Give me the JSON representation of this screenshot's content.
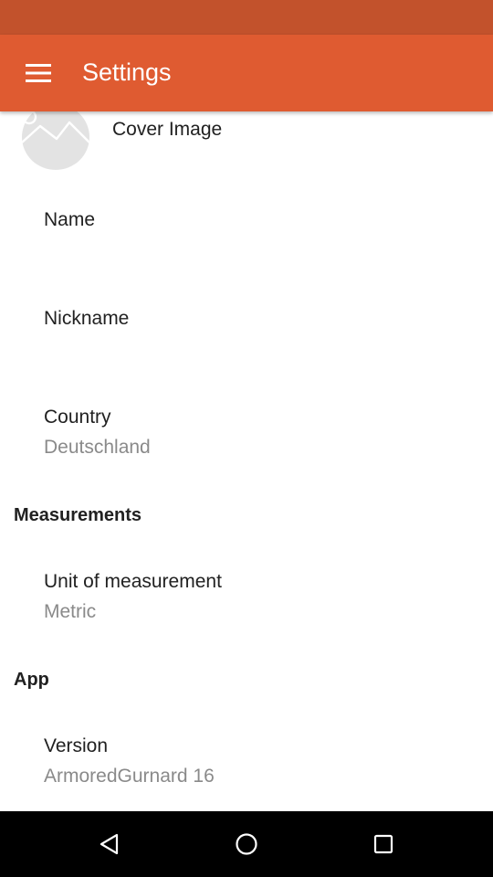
{
  "app_bar": {
    "title": "Settings",
    "menu_icon": "hamburger-menu-icon",
    "background": "#DF5B31",
    "status_bar_color": "#C2522C"
  },
  "cover": {
    "label": "Cover Image",
    "icon": "image-placeholder-icon"
  },
  "preferences": {
    "name": {
      "title": "Name"
    },
    "nickname": {
      "title": "Nickname"
    },
    "country": {
      "title": "Country",
      "value": "Deutschland"
    }
  },
  "measurements": {
    "header": "Measurements",
    "unit": {
      "title": "Unit of measurement",
      "value": "Metric"
    }
  },
  "app": {
    "header": "App",
    "version": {
      "title": "Version",
      "value": "ArmoredGurnard 16"
    }
  },
  "nav_bar": {
    "back_icon": "back-triangle-icon",
    "home_icon": "home-circle-icon",
    "recents_icon": "recents-square-icon"
  }
}
